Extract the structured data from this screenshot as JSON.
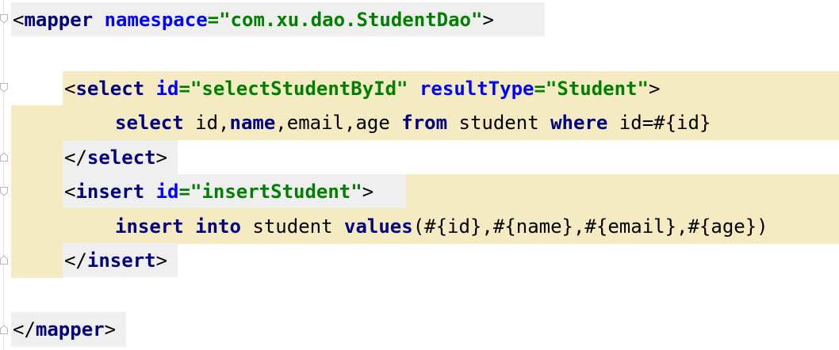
{
  "mapper_open": {
    "lt": "<",
    "tag": "mapper",
    "attr": "namespace",
    "eq": "=",
    "value": "\"com.xu.dao.StudentDao\"",
    "gt": ">"
  },
  "select_open": {
    "lt": "<",
    "tag": "select",
    "attr1": "id",
    "eq1": "=",
    "value1": "\"selectStudentById\"",
    "attr2": "resultType",
    "eq2": "=",
    "value2": "\"Student\"",
    "gt": ">"
  },
  "select_sql": {
    "kw1": "select",
    "t1": " id,",
    "kw2": "name",
    "t2": ",email,age ",
    "kw3": "from",
    "t3": " student ",
    "kw4": "where",
    "t4": " id=#{id}"
  },
  "select_close": {
    "lt": "</",
    "tag": "select",
    "gt": ">"
  },
  "insert_open": {
    "lt": "<",
    "tag": "insert",
    "attr": "id",
    "eq": "=",
    "value": "\"insertStudent\"",
    "gt": ">"
  },
  "insert_sql": {
    "kw1": "insert",
    "sp1": " ",
    "kw2": "into",
    "t1": " student ",
    "kw3": "values",
    "t2": "(#{id},#{name},#{email},#{age})"
  },
  "insert_close": {
    "lt": "</",
    "tag": "insert",
    "gt": ">"
  },
  "mapper_close": {
    "lt": "</",
    "tag": "mapper",
    "gt": ">"
  },
  "colors": {
    "tag": "#000080",
    "attribute": "#0000ff",
    "value": "#008000",
    "highlight": "#f5ebc2",
    "tag_background": "#efefef"
  }
}
